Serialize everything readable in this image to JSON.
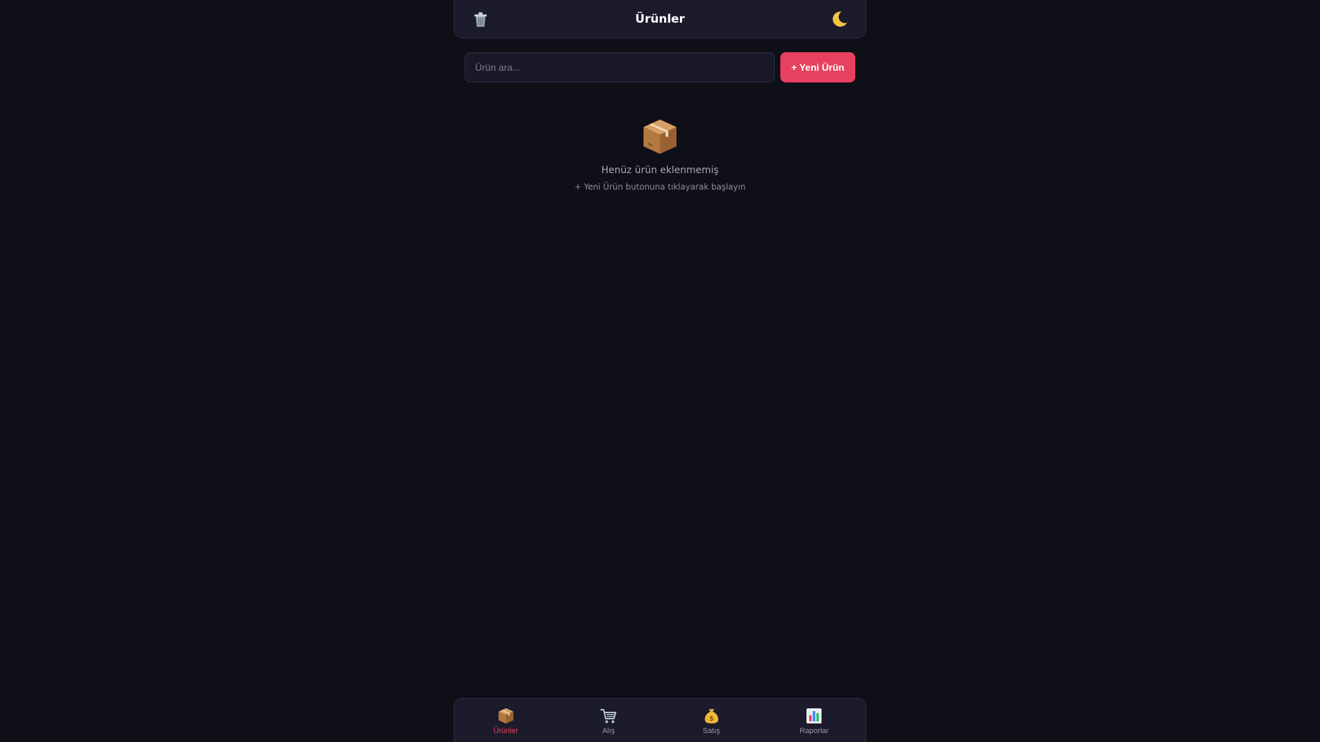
{
  "header": {
    "title": "Ürünler",
    "left_icon": "trash-icon",
    "right_icon": "moon-icon"
  },
  "search": {
    "placeholder": "Ürün ara...",
    "value": ""
  },
  "new_button": {
    "label": "+ Yeni Ürün"
  },
  "empty_state": {
    "icon": "package-icon",
    "message": "Henüz ürün eklenmemiş",
    "hint": "+ Yeni Ürün butonuna tıklayarak başlayın"
  },
  "nav": {
    "items": [
      {
        "label": "Ürünler",
        "icon": "package-icon",
        "active": true
      },
      {
        "label": "Alış",
        "icon": "cart-icon",
        "active": false
      },
      {
        "label": "Satış",
        "icon": "money-bag-icon",
        "active": false
      },
      {
        "label": "Raporlar",
        "icon": "bar-chart-icon",
        "active": false
      }
    ]
  },
  "colors": {
    "background": "#0f0f18",
    "surface": "#1b1b2c",
    "accent": "#e8405f",
    "text_muted": "#9a9aac"
  }
}
